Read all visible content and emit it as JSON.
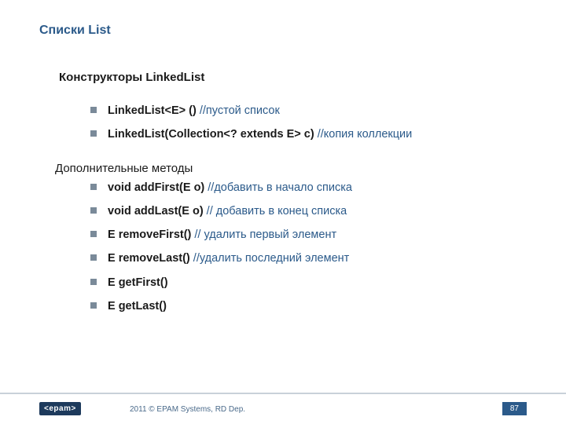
{
  "title": "Списки List",
  "section1": {
    "heading": "Конструкторы LinkedList",
    "items": [
      {
        "sig": "LinkedList<E> () ",
        "comment": "//пустой список"
      },
      {
        "sig": "LinkedList(Collection<? extends E> c)  ",
        "comment": "//копия коллекции"
      }
    ]
  },
  "section2": {
    "heading": "Дополнительные методы",
    "items": [
      {
        "sig": "void addFirst(E o) ",
        "comment": "//добавить в начало списка"
      },
      {
        "sig": "void addLast(E o) ",
        "comment": "// добавить в конец списка"
      },
      {
        "sig": "E removeFirst() ",
        "comment": "// удалить первый элемент"
      },
      {
        "sig": "E removeLast()  ",
        "comment": "//удалить последний элемент"
      },
      {
        "sig": "E getFirst()",
        "comment": ""
      },
      {
        "sig": "E getLast()",
        "comment": ""
      }
    ]
  },
  "footer": {
    "logo": "<epam>",
    "text": "2011 © EPAM Systems, RD Dep.",
    "page": "87"
  }
}
